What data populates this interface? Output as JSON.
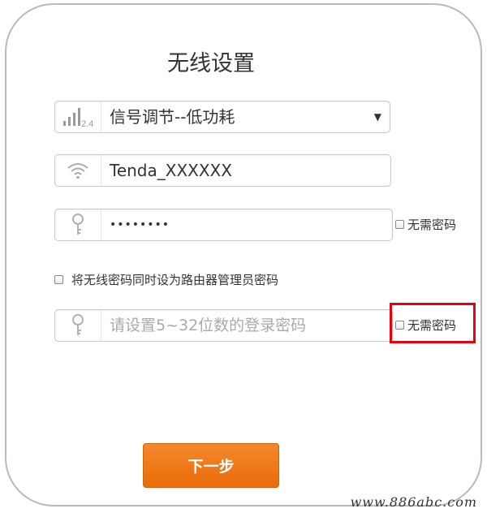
{
  "title": "无线设置",
  "signal_select": {
    "badge": "2.4",
    "value": "信号调节--低功耗",
    "icon": "signal-strength-icon"
  },
  "ssid_field": {
    "value": "Tenda_XXXXXX",
    "icon": "wifi-icon"
  },
  "wifi_password_field": {
    "value": "••••••••",
    "icon": "key-icon",
    "no_password_label": "无需密码"
  },
  "sync_admin_password": {
    "label": "将无线密码同时设为路由器管理员密码"
  },
  "login_password_field": {
    "placeholder": "请设置5~32位数的登录密码",
    "icon": "key-icon",
    "no_password_label": "无需密码"
  },
  "next_button": {
    "label": "下一步"
  },
  "watermark": "www.886abc.com",
  "colors": {
    "primary_button": "#ec730f",
    "highlight": "#e60012",
    "border": "#b9b9b9"
  }
}
